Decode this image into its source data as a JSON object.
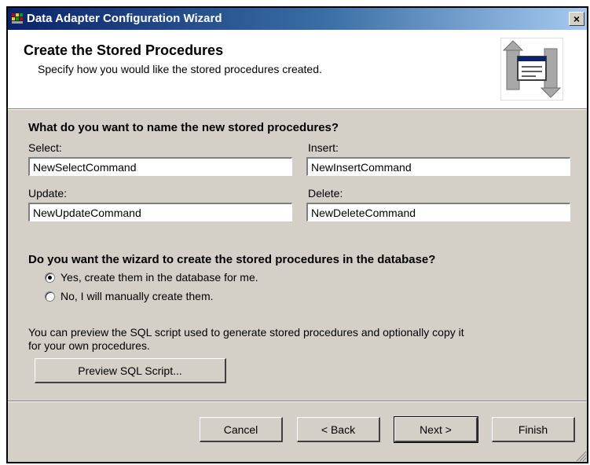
{
  "window": {
    "title": "Data Adapter Configuration Wizard",
    "close_label": "×"
  },
  "header": {
    "title": "Create the Stored Procedures",
    "subtitle": "Specify how you would like the stored procedures created."
  },
  "names_section": {
    "heading": "What do you want to name the new stored procedures?",
    "select_label": "Select:",
    "select_value": "NewSelectCommand",
    "insert_label": "Insert:",
    "insert_value": "NewInsertCommand",
    "update_label": "Update:",
    "update_value": "NewUpdateCommand",
    "delete_label": "Delete:",
    "delete_value": "NewDeleteCommand"
  },
  "create_section": {
    "heading": "Do you want the wizard to create the stored procedures in the database?",
    "options": [
      {
        "label": "Yes, create them in the database for me.",
        "checked": true
      },
      {
        "label": "No, I will manually create them.",
        "checked": false
      }
    ]
  },
  "preview_section": {
    "line1": "You can preview the SQL script used to generate stored procedures and optionally copy it",
    "line2": "for your own procedures.",
    "button_label": "Preview SQL Script..."
  },
  "footer": {
    "cancel_label": "Cancel",
    "back_label": "< Back",
    "next_label": "Next >",
    "finish_label": "Finish"
  }
}
